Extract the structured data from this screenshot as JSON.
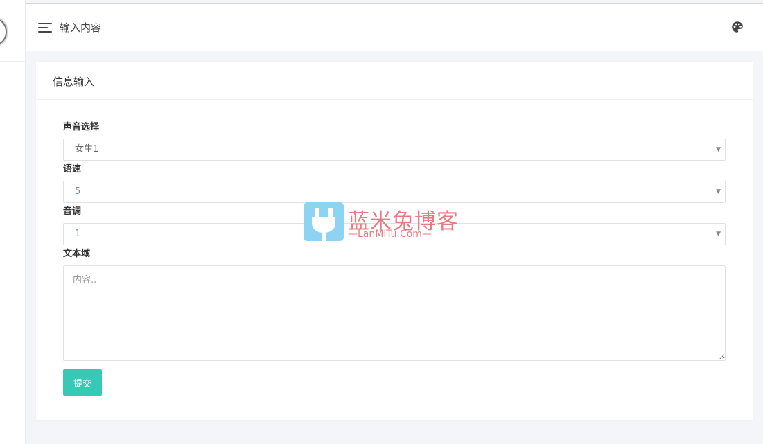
{
  "header": {
    "title": "输入内容",
    "menu_icon": "hamburger-icon",
    "theme_icon": "palette-icon"
  },
  "card": {
    "title": "信息输入"
  },
  "form": {
    "voice": {
      "label": "声音选择",
      "value": "女生1"
    },
    "speed": {
      "label": "语速",
      "value": "5"
    },
    "pitch": {
      "label": "音调",
      "value": "1"
    },
    "text": {
      "label": "文本域",
      "placeholder": "内容..",
      "value": ""
    },
    "submit_label": "提交"
  },
  "watermark": {
    "text": "蓝米兔博客",
    "sub": "—LanMiTu.Com—"
  },
  "colors": {
    "accent": "#35c9b6",
    "background": "#f4f5f8",
    "watermark_blue": "#8ed3f2",
    "watermark_red": "#e77a82"
  }
}
